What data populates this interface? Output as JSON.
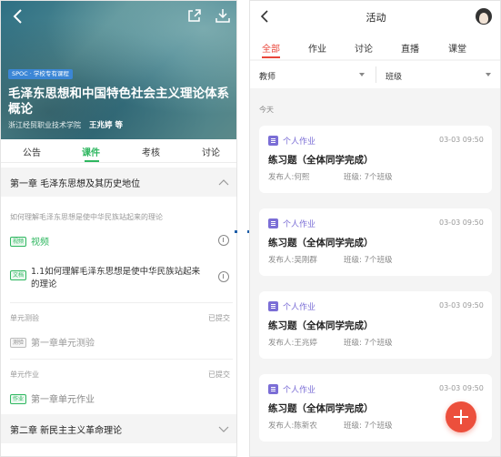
{
  "left": {
    "hero": {
      "tag": "SPOC · 学校专有课程",
      "course_title": "毛泽东思想和中国特色社会主义理论体系概论",
      "school": "浙江经贸职业技术学院",
      "teacher": "王兆婷 等"
    },
    "tabs": [
      {
        "label": "公告",
        "active": false
      },
      {
        "label": "课件",
        "active": true
      },
      {
        "label": "考核",
        "active": false
      },
      {
        "label": "讨论",
        "active": false
      }
    ],
    "chapter1": {
      "title": "第一章 毛泽东思想及其历史地位"
    },
    "section1": {
      "label": "如何理解毛泽东思想是使中华民族站起来的理论",
      "video_tag": "视频",
      "video_title": "视频",
      "doc_tag": "文档",
      "doc_title": "1.1如何理解毛泽东思想是使中华民族站起来的理论"
    },
    "unit_test": {
      "label": "单元测验",
      "status": "已提交",
      "tag": "测验",
      "title": "第一章单元测验"
    },
    "unit_hw": {
      "label": "单元作业",
      "status": "已提交",
      "tag": "作业",
      "title": "第一章单元作业"
    },
    "chapter2": {
      "title": "第二章 新民主主义革命理论"
    }
  },
  "right": {
    "header": {
      "title": "活动"
    },
    "tabs": [
      {
        "label": "全部",
        "active": true
      },
      {
        "label": "作业",
        "active": false
      },
      {
        "label": "讨论",
        "active": false
      },
      {
        "label": "直播",
        "active": false
      },
      {
        "label": "课堂",
        "active": false
      }
    ],
    "filters": {
      "teacher": "教师",
      "class": "班级"
    },
    "today": "今天",
    "cards": [
      {
        "type": "个人作业",
        "date": "03-03 09:50",
        "title": "练习题（全体同学完成）",
        "publisher": "发布人:何熙",
        "classes": "班级: 7个班级"
      },
      {
        "type": "个人作业",
        "date": "03-03 09:50",
        "title": "练习题（全体同学完成）",
        "publisher": "发布人:吴刚群",
        "classes": "班级: 7个班级"
      },
      {
        "type": "个人作业",
        "date": "03-03 09:50",
        "title": "练习题（全体同学完成）",
        "publisher": "发布人:王兆婷",
        "classes": "班级: 7个班级"
      },
      {
        "type": "个人作业",
        "date": "03-03 09:50",
        "title": "练习题（全体同学完成）",
        "publisher": "发布人:陈新农",
        "classes": "班级: 7个班级"
      }
    ]
  },
  "colors": {
    "accent_green": "#2fb760",
    "accent_red": "#e9463a",
    "purple": "#7b6ed6"
  }
}
